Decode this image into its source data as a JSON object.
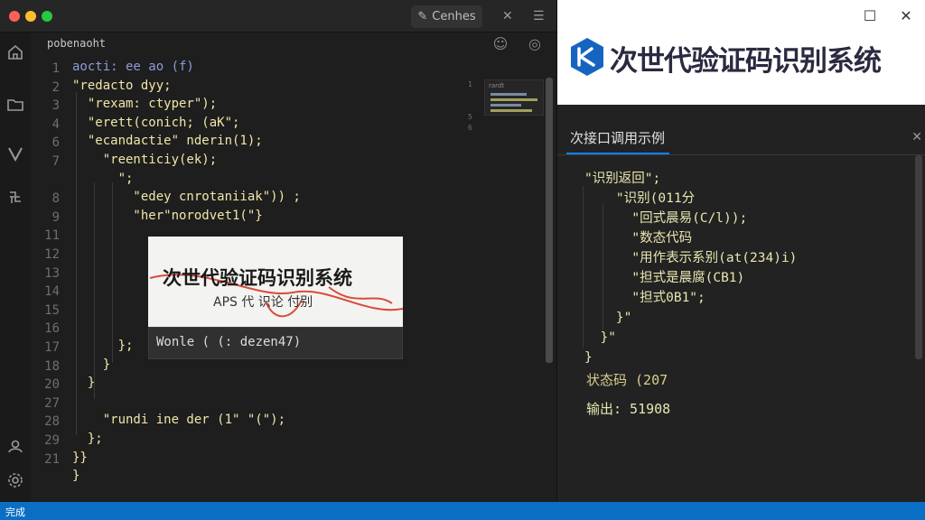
{
  "editor": {
    "titlebar_button": "Cenhes",
    "breadcrumb": "pobenaoht",
    "line_numbers": [
      "1",
      "2",
      "3",
      "4",
      "6",
      "7",
      "",
      "8",
      "9",
      "11",
      "12",
      "13",
      "14",
      "15",
      "16",
      "17",
      "18",
      "20",
      "27",
      "28",
      "29",
      "21"
    ],
    "code_lines": [
      "aocti: ee ao (f)",
      "\"redacto dyy;",
      "  \"rexam: ctyper\");",
      "  \"erett(conich; (aK\";",
      "  \"ecandactie\" nderin(1);",
      "    \"reenticiy(ek);",
      "      \";",
      "        \"edey cnrotaniiak\")) ;",
      "        \"her\"norodvet1(\"}",
      "",
      "",
      "",
      "",
      "",
      "",
      "      };",
      "    }",
      "  }",
      "",
      "    \"rundi ine der (1\" \"(\");",
      "  };",
      "}}",
      "}"
    ],
    "minimap_label": "rardt",
    "minimap_side": [
      "1",
      "",
      "",
      "5",
      "6"
    ],
    "overlay_title": "次世代验证码识别系统",
    "overlay_subtitle": "APS 代 识论 付别",
    "hover_text": "Wonle (  (: dezen47)"
  },
  "right_panel": {
    "brand_title": "次世代验证码识别系统",
    "tab_label": "次接口调用示例",
    "code_lines": [
      "\"识别返回\";",
      "    \"识别(011分",
      "      \"回式晨易(C/l));",
      "      \"数态代码",
      "      \"用作表示系别(at(234)i)",
      "      \"担式是晨腐(CB1)",
      "      \"担式0B1\";",
      "    }\"",
      "  }\"",
      "}"
    ],
    "status_code": "状态码 (207",
    "output": "输出: 51908"
  },
  "statusbar": {
    "label": "完成"
  },
  "colors": {
    "accent": "#0a84ff",
    "statusbar": "#0a6fc4",
    "code": "#f0e6a8",
    "scribble": "#d94b3a"
  }
}
